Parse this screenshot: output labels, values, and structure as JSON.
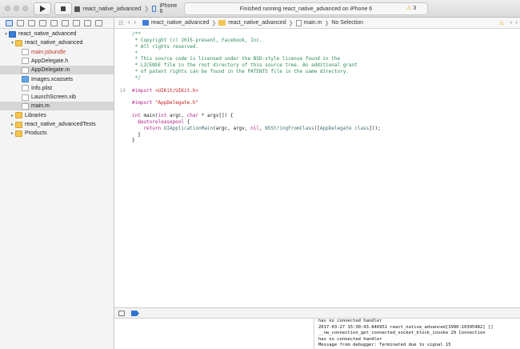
{
  "toolbar": {
    "scheme_target": "react_native_advanced",
    "device": "iPhone 6",
    "status": "Finished running react_native_advanced on iPhone 6",
    "warning_count": "3"
  },
  "navigator": {
    "items": [
      {
        "label": "react_native_advanced",
        "icon": "project",
        "disclosure": "▾",
        "indent": 0,
        "selected": false,
        "red": false
      },
      {
        "label": "react_native_advanced",
        "icon": "folder",
        "disclosure": "▾",
        "indent": 1,
        "selected": false,
        "red": false
      },
      {
        "label": "main.jsbundle",
        "icon": "file",
        "disclosure": "",
        "indent": 2,
        "selected": false,
        "red": true
      },
      {
        "label": "AppDelegate.h",
        "icon": "header",
        "disclosure": "",
        "indent": 2,
        "selected": false,
        "red": false
      },
      {
        "label": "AppDelegate.m",
        "icon": "file",
        "disclosure": "",
        "indent": 2,
        "selected": true,
        "red": false
      },
      {
        "label": "Images.xcassets",
        "icon": "asset",
        "disclosure": "",
        "indent": 2,
        "selected": false,
        "red": false
      },
      {
        "label": "Info.plist",
        "icon": "file",
        "disclosure": "",
        "indent": 2,
        "selected": false,
        "red": false
      },
      {
        "label": "LaunchScreen.xib",
        "icon": "file",
        "disclosure": "",
        "indent": 2,
        "selected": false,
        "red": false
      },
      {
        "label": "main.m",
        "icon": "file",
        "disclosure": "",
        "indent": 2,
        "selected": true,
        "red": false
      },
      {
        "label": "Libraries",
        "icon": "folder",
        "disclosure": "▸",
        "indent": 1,
        "selected": false,
        "red": false
      },
      {
        "label": "react_native_advancedTests",
        "icon": "folder",
        "disclosure": "▸",
        "indent": 1,
        "selected": false,
        "red": false
      },
      {
        "label": "Products",
        "icon": "folder",
        "disclosure": "▸",
        "indent": 1,
        "selected": false,
        "red": false
      }
    ]
  },
  "jumpbar": {
    "project": "react_native_advanced",
    "group": "react_native_advanced",
    "file": "main.m",
    "selection": "No Selection"
  },
  "editor": {
    "lines": [
      {
        "n": "",
        "parts": [
          {
            "t": "/**",
            "c": "c-com"
          }
        ]
      },
      {
        "n": "",
        "parts": [
          {
            "t": " * Copyright (c) 2015-present, Facebook, Inc.",
            "c": "c-com"
          }
        ]
      },
      {
        "n": "",
        "parts": [
          {
            "t": " * All rights reserved.",
            "c": "c-com"
          }
        ]
      },
      {
        "n": "",
        "parts": [
          {
            "t": " *",
            "c": "c-com"
          }
        ]
      },
      {
        "n": "",
        "parts": [
          {
            "t": " * This source code is licensed under the BSD-style license found in the",
            "c": "c-com"
          }
        ]
      },
      {
        "n": "",
        "parts": [
          {
            "t": " * LICENSE file in the root directory of this source tree. An additional grant",
            "c": "c-com"
          }
        ]
      },
      {
        "n": "",
        "parts": [
          {
            "t": " * of patent rights can be found in the PATENTS file in the same directory.",
            "c": "c-com"
          }
        ]
      },
      {
        "n": "",
        "parts": [
          {
            "t": " */",
            "c": "c-com"
          }
        ]
      },
      {
        "n": "",
        "parts": []
      },
      {
        "n": "10",
        "parts": [
          {
            "t": "#import ",
            "c": "c-kw"
          },
          {
            "t": "<UIKit/UIKit.h>",
            "c": "c-str"
          }
        ]
      },
      {
        "n": "",
        "parts": []
      },
      {
        "n": "",
        "parts": [
          {
            "t": "#import ",
            "c": "c-kw"
          },
          {
            "t": "\"AppDelegate.h\"",
            "c": "c-str"
          }
        ]
      },
      {
        "n": "",
        "parts": []
      },
      {
        "n": "",
        "parts": [
          {
            "t": "int ",
            "c": "c-kw"
          },
          {
            "t": "main(",
            "c": "c-plain"
          },
          {
            "t": "int ",
            "c": "c-kw"
          },
          {
            "t": "argc, ",
            "c": "c-plain"
          },
          {
            "t": "char ",
            "c": "c-kw"
          },
          {
            "t": "* argv[]) {",
            "c": "c-plain"
          }
        ]
      },
      {
        "n": "",
        "parts": [
          {
            "t": "  @autoreleasepool ",
            "c": "c-kw"
          },
          {
            "t": "{",
            "c": "c-plain"
          }
        ]
      },
      {
        "n": "",
        "parts": [
          {
            "t": "    return ",
            "c": "c-kw"
          },
          {
            "t": "UIApplicationMain",
            "c": "c-fn"
          },
          {
            "t": "(argc, argv, ",
            "c": "c-plain"
          },
          {
            "t": "nil",
            "c": "c-kw"
          },
          {
            "t": ", ",
            "c": "c-plain"
          },
          {
            "t": "NSStringFromClass",
            "c": "c-fn"
          },
          {
            "t": "([",
            "c": "c-plain"
          },
          {
            "t": "AppDelegate class",
            "c": "c-fn"
          },
          {
            "t": "]));",
            "c": "c-plain"
          }
        ]
      },
      {
        "n": "",
        "parts": [
          {
            "t": "  }",
            "c": "c-plain"
          }
        ]
      },
      {
        "n": "",
        "parts": [
          {
            "t": "}",
            "c": "c-plain"
          }
        ]
      }
    ]
  },
  "console": {
    "lines": [
      "has no connected handler",
      "2017-03-27 15:30:43.846951 react_native_advanced[3990:10395482] []",
      "__nw_connection_get_connected_socket_block_invoke 29 Connection",
      "has no connected handler",
      "Message from debugger: Terminated due to signal 15"
    ]
  },
  "colors": {
    "accent": "#2f74d0",
    "comment": "#2e8b57",
    "keyword": "#b0238a",
    "string": "#c41a16"
  }
}
